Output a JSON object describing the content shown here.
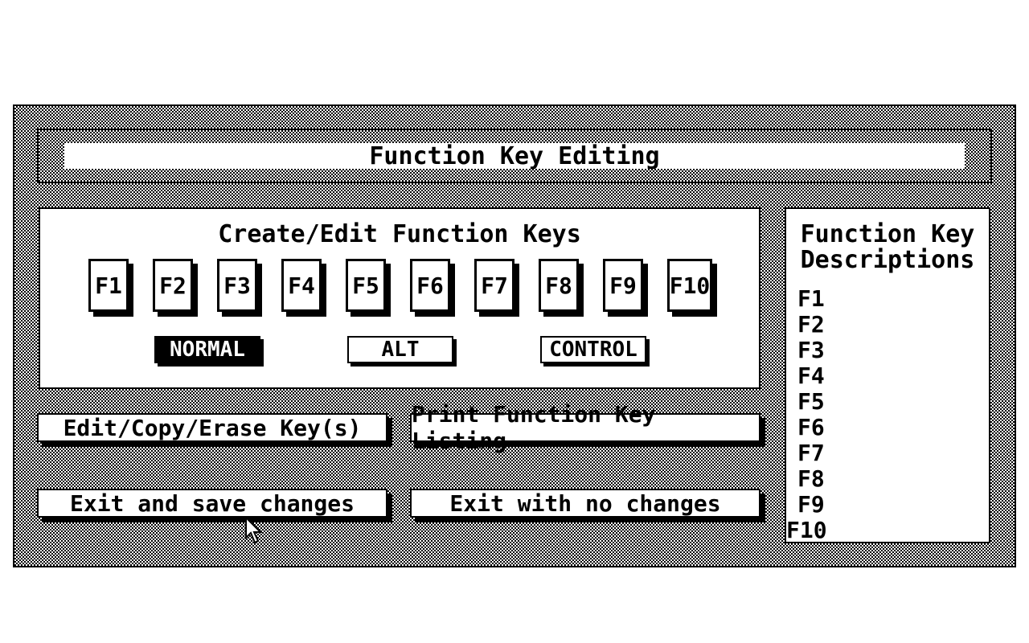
{
  "dialog": {
    "title": "Function Key Editing"
  },
  "edit_panel": {
    "title": "Create/Edit Function Keys",
    "keys": [
      "F1",
      "F2",
      "F3",
      "F4",
      "F5",
      "F6",
      "F7",
      "F8",
      "F9",
      "F10"
    ],
    "modes": [
      {
        "label": "NORMAL",
        "selected": true
      },
      {
        "label": "ALT",
        "selected": false
      },
      {
        "label": "CONTROL",
        "selected": false
      }
    ]
  },
  "actions": {
    "edit_copy_erase": "Edit/Copy/Erase Key(s)",
    "print_listing": "Print Function Key Listing",
    "exit_save": "Exit and save changes",
    "exit_no_changes": "Exit with no changes"
  },
  "descriptions": {
    "title_line1": "Function Key",
    "title_line2": "Descriptions",
    "rows": [
      "F1",
      "F2",
      "F3",
      "F4",
      "F5",
      "F6",
      "F7",
      "F8",
      "F9",
      "F10"
    ]
  },
  "icons": {
    "cursor": "mouse-pointer-icon"
  },
  "colors": {
    "foreground": "#000000",
    "background": "#ffffff"
  }
}
